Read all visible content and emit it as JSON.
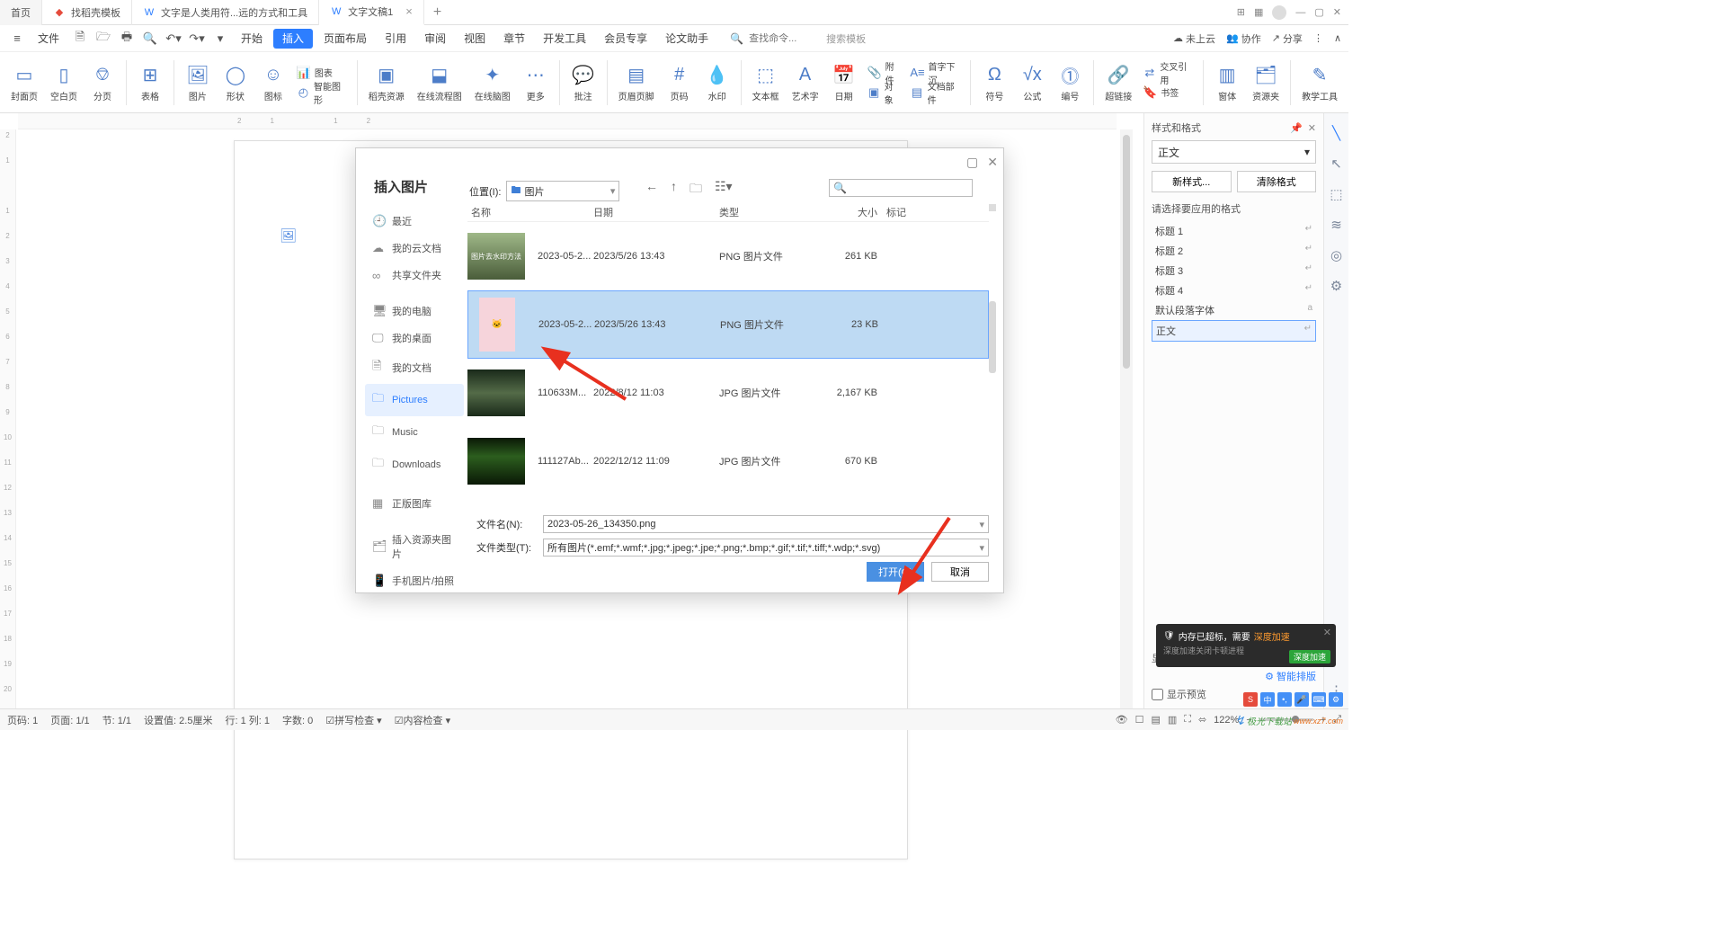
{
  "tabs": {
    "home": "首页",
    "t1": "找稻壳模板",
    "t2": "文字是人类用符...远的方式和工具",
    "t3": "文字文稿1"
  },
  "menu": {
    "file": "文件",
    "items": [
      "开始",
      "插入",
      "页面布局",
      "引用",
      "审阅",
      "视图",
      "章节",
      "开发工具",
      "会员专享",
      "论文助手"
    ],
    "search_cmd": "查找命令...",
    "search_tmpl": "搜索模板",
    "right": {
      "cloud": "未上云",
      "coop": "协作",
      "share": "分享"
    }
  },
  "ribbon": {
    "items": [
      "封面页",
      "空白页",
      "分页",
      "表格",
      "图片",
      "形状",
      "图标",
      "智能图形",
      "稻壳资源",
      "在线流程图",
      "在线脑图",
      "更多",
      "批注",
      "页眉页脚",
      "页码",
      "水印",
      "文本框",
      "艺术字",
      "日期",
      "符号",
      "公式",
      "编号",
      "超链接",
      "窗体",
      "资源夹",
      "教学工具"
    ],
    "small": {
      "chart": "图表",
      "attach": "附件",
      "obj": "对象",
      "docpart": "文档部件",
      "dropcap": "首字下沉",
      "crossref": "交叉引用",
      "bookmark": "书签"
    }
  },
  "right_panel": {
    "title": "样式和格式",
    "current": "正文",
    "btn_new": "新样式...",
    "btn_clear": "清除格式",
    "apply_label": "请选择要应用的格式",
    "list": [
      "标题 1",
      "标题 2",
      "标题 3",
      "标题 4",
      "默认段落字体",
      "正文"
    ],
    "preview": "显示预览",
    "smart": "智能排版"
  },
  "dialog": {
    "title": "插入图片",
    "loc_label": "位置(I):",
    "loc_value": "图片",
    "cols": {
      "name": "名称",
      "date": "日期",
      "type": "类型",
      "size": "大小",
      "mark": "标记"
    },
    "sidebar": {
      "recent": "最近",
      "cloud": "我的云文档",
      "shared": "共享文件夹",
      "pc": "我的电脑",
      "desktop": "我的桌面",
      "docs": "我的文档",
      "pictures": "Pictures",
      "music": "Music",
      "downloads": "Downloads",
      "gallery": "正版图库",
      "res": "插入资源夹图片",
      "phone": "手机图片/拍照"
    },
    "rows": [
      {
        "name": "2023-05-2...",
        "date": "2023/5/26 13:43",
        "type": "PNG 图片文件",
        "size": "261 KB",
        "thumb_text": "图片去水印方法"
      },
      {
        "name": "2023-05-2...",
        "date": "2023/5/26 13:43",
        "type": "PNG 图片文件",
        "size": "23 KB"
      },
      {
        "name": "110633M...",
        "date": "2022/8/12 11:03",
        "type": "JPG 图片文件",
        "size": "2,167 KB"
      },
      {
        "name": "111127Ab...",
        "date": "2022/12/12 11:09",
        "type": "JPG 图片文件",
        "size": "670 KB"
      }
    ],
    "fn_label": "文件名(N):",
    "fn_value": "2023-05-26_134350.png",
    "ft_label": "文件类型(T):",
    "ft_value": "所有图片(*.emf;*.wmf;*.jpg;*.jpeg;*.jpe;*.png;*.bmp;*.gif;*.tif;*.tiff;*.wdp;*.svg)",
    "open": "打开(O)",
    "cancel": "取消"
  },
  "notif": {
    "title_a": "内存已超标，需要",
    "title_b": "深度加速",
    "sub": "深度加速关闭卡顿进程",
    "btn": "深度加速"
  },
  "status": {
    "page": "页码: 1",
    "pages": "页面: 1/1",
    "sec": "节: 1/1",
    "set": "设置值: 2.5厘米",
    "rowcol": "行: 1  列: 1",
    "words": "字数: 0",
    "spell": "拼写检查",
    "content": "内容检查",
    "zoom": "122%"
  },
  "watermark": {
    "brand": "极光下载站",
    "url": "www.xz7.com"
  },
  "misc": {
    "display": "显"
  }
}
